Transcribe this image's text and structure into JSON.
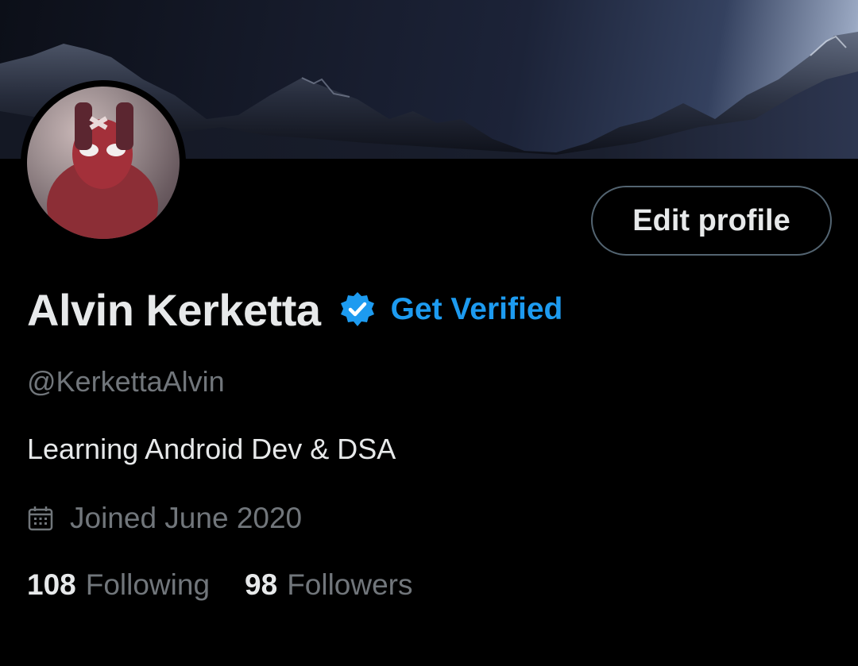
{
  "profile": {
    "display_name": "Alvin Kerketta",
    "handle": "@KerkettaAlvin",
    "bio": "Learning Android Dev & DSA",
    "joined": "Joined June 2020",
    "get_verified_label": "Get Verified",
    "edit_profile_label": "Edit profile",
    "verified_icon": "verified-badge-icon",
    "calendar_icon": "calendar-icon"
  },
  "stats": {
    "following_count": "108",
    "following_label": "Following",
    "followers_count": "98",
    "followers_label": "Followers"
  },
  "colors": {
    "background": "#000000",
    "accent": "#1d9bf0",
    "primary_text": "#e7e9ea",
    "secondary_text": "#71767b",
    "button_border": "#536471"
  }
}
